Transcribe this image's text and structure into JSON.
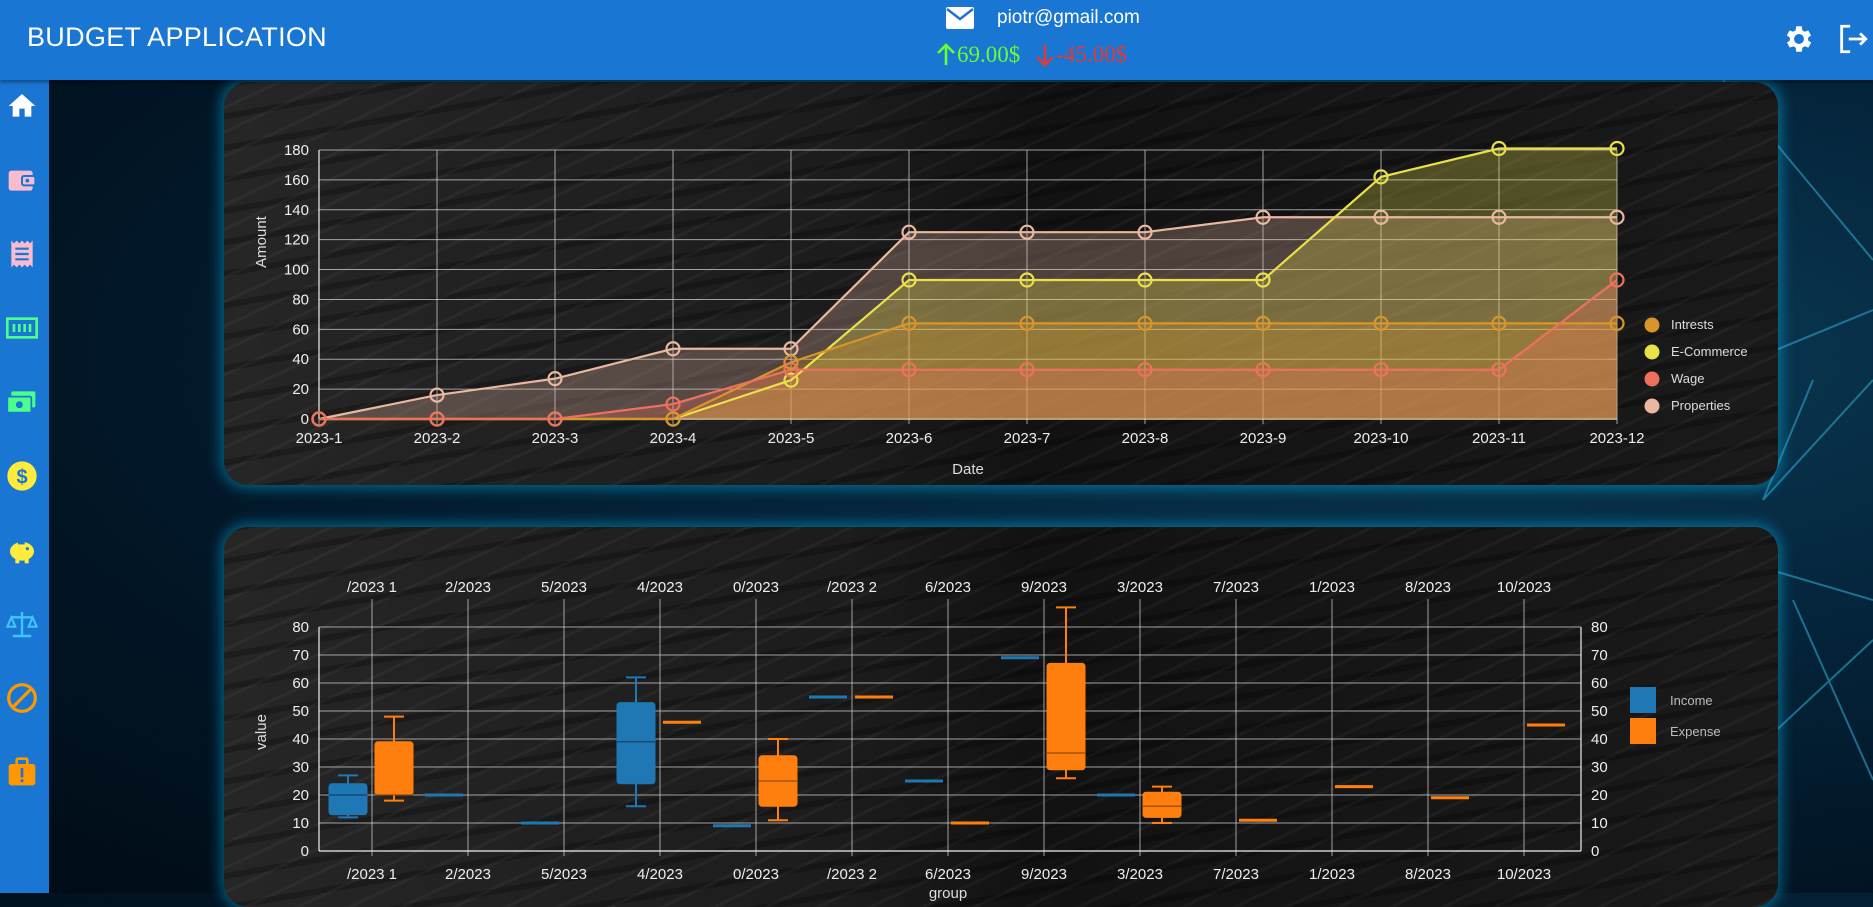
{
  "header": {
    "title": "BUDGET APPLICATION",
    "email": "piotr@gmail.com",
    "income": "69.00$",
    "expense": "-45.00$"
  },
  "icons": {
    "top": [
      "mail-icon",
      "settings-gear-icon",
      "logout-icon"
    ],
    "sidebar": [
      "home-icon",
      "wallet-icon",
      "receipt-icon",
      "money-bill-icon",
      "payments-icon",
      "dollar-coin-icon",
      "piggy-bank-icon",
      "balance-scale-icon",
      "block-icon",
      "report-icon"
    ]
  },
  "colors": {
    "topbar": "#1976d2",
    "income": "#66ff33",
    "expense": "#e53935",
    "intrests": "#d8962a",
    "ecommerce": "#e9e14a",
    "wage": "#f07060",
    "properties": "#e8b8a0",
    "box_income": "#1f77b4",
    "box_expense": "#ff7f0e"
  },
  "chart_data": [
    {
      "type": "area",
      "title": "",
      "xlabel": "Date",
      "ylabel": "Amount",
      "ylim": [
        0,
        180
      ],
      "yticks": [
        0,
        20,
        40,
        60,
        80,
        100,
        120,
        140,
        160,
        180
      ],
      "categories": [
        "2023-1",
        "2023-2",
        "2023-3",
        "2023-4",
        "2023-5",
        "2023-6",
        "2023-7",
        "2023-8",
        "2023-9",
        "2023-10",
        "2023-11",
        "2023-12"
      ],
      "grid": true,
      "legend_position": "right",
      "series": [
        {
          "name": "Intrests",
          "color": "#d8962a",
          "values": [
            0,
            0,
            0,
            0,
            38,
            64,
            64,
            64,
            64,
            64,
            64,
            64
          ]
        },
        {
          "name": "E-Commerce",
          "color": "#e9e14a",
          "values": [
            0,
            0,
            0,
            0,
            26,
            93,
            93,
            93,
            93,
            162,
            181,
            181
          ]
        },
        {
          "name": "Wage",
          "color": "#f07060",
          "values": [
            0,
            0,
            0,
            10,
            33,
            33,
            33,
            33,
            33,
            33,
            33,
            93
          ]
        },
        {
          "name": "Properties",
          "color": "#e8b8a0",
          "values": [
            0,
            16,
            27,
            47,
            47,
            125,
            125,
            125,
            135,
            135,
            135,
            135
          ]
        }
      ]
    },
    {
      "type": "box",
      "title": "",
      "xlabel": "group",
      "ylabel": "value",
      "ylim": [
        0,
        80
      ],
      "yticks": [
        0,
        10,
        20,
        30,
        40,
        50,
        60,
        70,
        80
      ],
      "categories": [
        "/2023 1",
        "2/2023",
        "5/2023",
        "4/2023",
        "0/2023",
        "/2023 2",
        "6/2023",
        "9/2023",
        "3/2023",
        "7/2023",
        "1/2023",
        "8/2023",
        "10/2023"
      ],
      "grid": true,
      "legend_position": "right",
      "series": [
        {
          "name": "Income",
          "color": "#1f77b4",
          "boxes": [
            [
              12,
              13,
              20,
              24,
              27
            ],
            [
              20,
              20,
              20,
              20,
              20
            ],
            [
              10,
              10,
              10,
              10,
              10
            ],
            [
              16,
              24,
              39,
              53,
              62
            ],
            [
              9,
              9,
              9,
              9,
              9
            ],
            [
              55,
              55,
              55,
              55,
              55
            ],
            [
              25,
              25,
              25,
              25,
              25
            ],
            [
              69,
              69,
              69,
              69,
              69
            ],
            [
              20,
              20,
              20,
              20,
              20
            ],
            null,
            null,
            null,
            null
          ]
        },
        {
          "name": "Expense",
          "color": "#ff7f0e",
          "boxes": [
            [
              18,
              20,
              20,
              39,
              48
            ],
            null,
            null,
            [
              46,
              46,
              46,
              46,
              46
            ],
            [
              11,
              16,
              25,
              34,
              40
            ],
            [
              55,
              55,
              55,
              55,
              55
            ],
            [
              10,
              10,
              10,
              10,
              10
            ],
            [
              26,
              29,
              35,
              67,
              87
            ],
            [
              10,
              12,
              16,
              21,
              23
            ],
            [
              11,
              11,
              11,
              11,
              11
            ],
            [
              23,
              23,
              23,
              23,
              23
            ],
            [
              19,
              19,
              19,
              19,
              19
            ],
            [
              45,
              45,
              45,
              45,
              45
            ]
          ]
        }
      ]
    }
  ]
}
